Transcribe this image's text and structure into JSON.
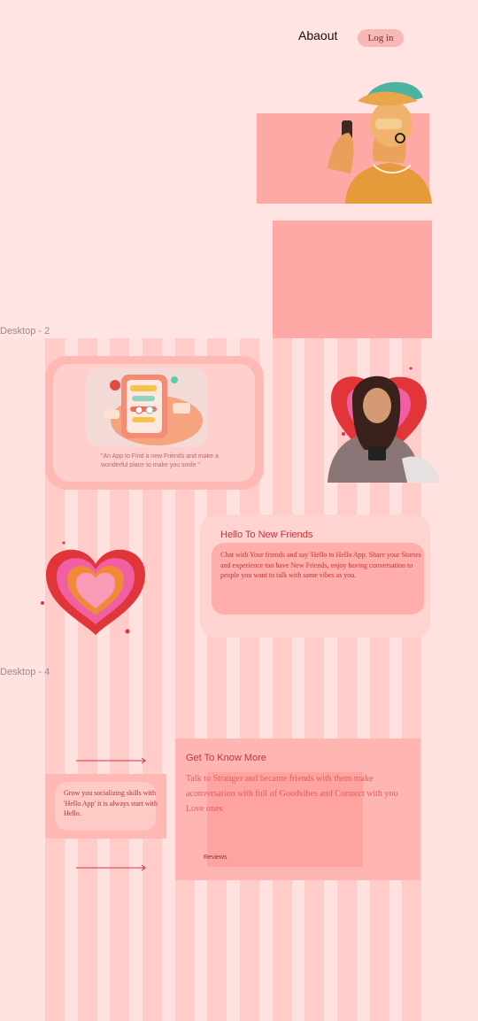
{
  "header": {
    "about_label": "Abaout",
    "login_label": "Log in"
  },
  "frames": {
    "desktop2_label": "Desktop - 2",
    "desktop4_label": "Desktop - 4"
  },
  "card_app": {
    "tagline": "\"An App to Find a new Friends and make a wonderful place to make you smile \""
  },
  "hello_section": {
    "title": "Hello To New Friends",
    "body": "Chat with Your friends and say 'Hello to Hello App. Share your Stories and experience too have New Friends, enjoy having conversation to people you want to talk with same vibes as you."
  },
  "grow_section": {
    "text": "Grow you socializing skills with 'Hello App' it is always start with Hello."
  },
  "know_section": {
    "title": "Get To Know More",
    "body": "Talk to Stranger and became friends with them make aconversation with full of Goodvibes and Connect with you Love ones",
    "reviews_label": "Reviews"
  },
  "colors": {
    "background": "#ffe4e3",
    "accent": "#c0353a",
    "block": "#ffa9a6"
  },
  "icons": [
    "arrow-right-icon",
    "heart-icon",
    "phone-illustration-icon"
  ]
}
